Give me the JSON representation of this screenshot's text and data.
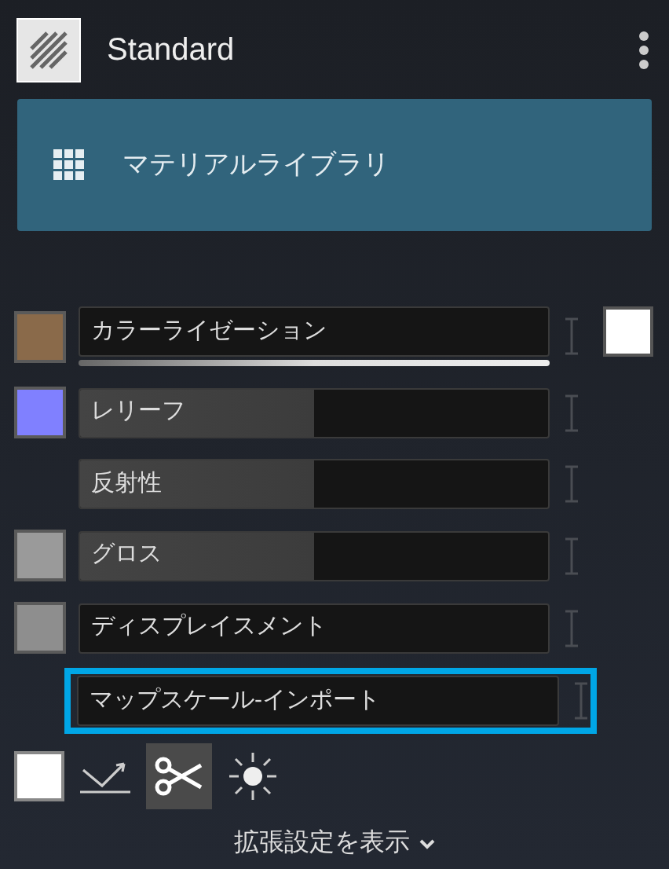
{
  "header": {
    "title": "Standard"
  },
  "library_button": {
    "label": "マテリアルライブラリ"
  },
  "channels": [
    {
      "label": "カラーライゼーション",
      "kind": "color",
      "color": "#8a6a4a",
      "side_swatch": {
        "color": "#ffffff"
      },
      "highlighted": false
    },
    {
      "label": "レリーフ",
      "kind": "slider",
      "color": "#8080ff",
      "level": 0.5,
      "highlighted": false
    },
    {
      "label": "反射性",
      "kind": "slider",
      "level": 0.5,
      "highlighted": false
    },
    {
      "label": "グロス",
      "kind": "slider",
      "color": "#9a9a9a",
      "level": 0.5,
      "highlighted": false
    },
    {
      "label": "ディスプレイスメント",
      "kind": "field",
      "color": "#8e8e8e",
      "highlighted": false
    },
    {
      "label": "マップスケール-インポート",
      "kind": "field",
      "highlighted": true
    }
  ],
  "tools": [
    {
      "kind": "swatch",
      "color": "#ffffff",
      "selected": false
    },
    {
      "kind": "reflect",
      "selected": false
    },
    {
      "kind": "cut",
      "selected": true
    },
    {
      "kind": "light",
      "selected": false
    }
  ],
  "footer": {
    "label": "拡張設定を表示"
  }
}
